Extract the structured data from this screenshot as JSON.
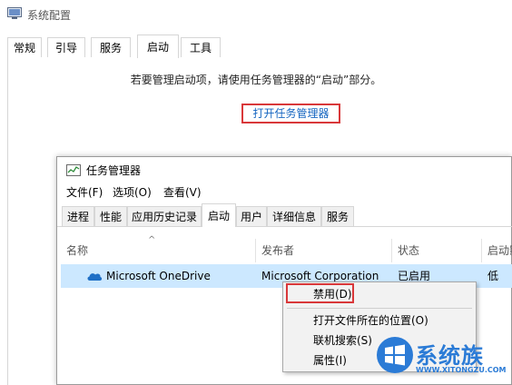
{
  "sys_config": {
    "title": "系统配置",
    "tabs": [
      "常规",
      "引导",
      "服务",
      "启动",
      "工具"
    ],
    "active_tab_index": 3,
    "notice": "若要管理启动项，请使用任务管理器的“启动”部分。",
    "open_task_manager_link": "打开任务管理器"
  },
  "task_manager": {
    "title": "任务管理器",
    "menu": [
      "文件(F)",
      "选项(O)",
      "查看(V)"
    ],
    "tabs": [
      "进程",
      "性能",
      "应用历史记录",
      "启动",
      "用户",
      "详细信息",
      "服务"
    ],
    "active_tab_index": 3,
    "columns": [
      "名称",
      "发布者",
      "状态",
      "启动影"
    ],
    "rows": [
      {
        "name": "Microsoft OneDrive",
        "publisher": "Microsoft Corporation",
        "status": "已启用",
        "impact": "低"
      }
    ]
  },
  "context_menu": {
    "items": [
      "禁用(D)",
      "打开文件所在的位置(O)",
      "联机搜索(S)",
      "属性(I)"
    ]
  },
  "watermark": {
    "text": "系统族",
    "url": "WWW.XITONGZU.COM"
  },
  "colors": {
    "highlight_red": "#d9383a",
    "link_blue": "#1565c0",
    "row_selected": "#cce8ff",
    "watermark_blue": "#2b7bd6"
  }
}
